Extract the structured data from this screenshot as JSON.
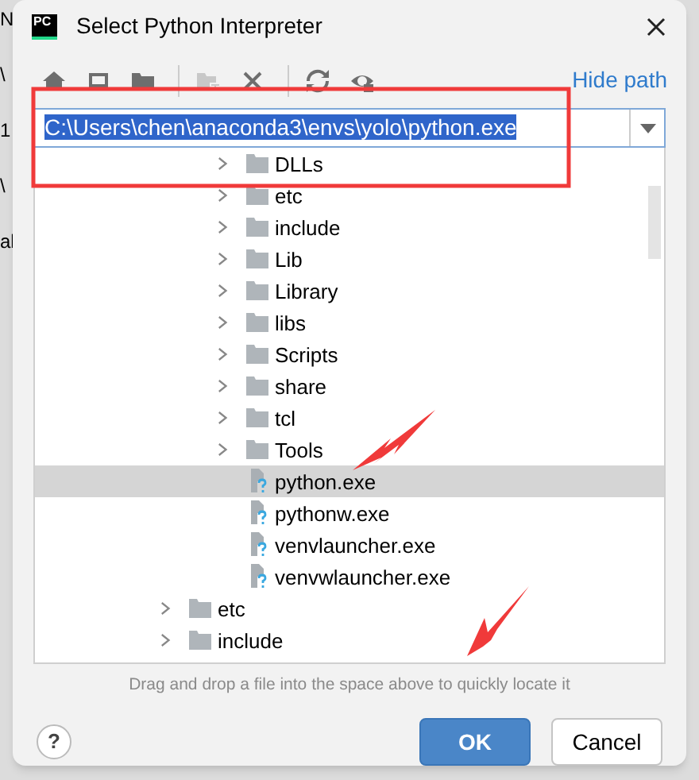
{
  "background_fragments": [
    "N",
    "\\",
    "1",
    "\\",
    "al"
  ],
  "window": {
    "title": "Select Python Interpreter",
    "logo": "PC"
  },
  "toolbar": [
    {
      "kind": "home",
      "disabled": false
    },
    {
      "kind": "desktop",
      "disabled": false
    },
    {
      "kind": "project",
      "disabled": false
    },
    {
      "kind": "separator"
    },
    {
      "kind": "new-folder",
      "disabled": true
    },
    {
      "kind": "delete",
      "disabled": false
    },
    {
      "kind": "separator"
    },
    {
      "kind": "refresh",
      "disabled": false
    },
    {
      "kind": "show-hidden",
      "disabled": false
    }
  ],
  "hide_path_link": "Hide path",
  "path_field": {
    "value": "C:\\Users\\chen\\anaconda3\\envs\\yolo\\python.exe",
    "selected": true
  },
  "tree": [
    {
      "children": [
        {
          "label": "DLLs",
          "kind": "folder",
          "expanded": false,
          "selected": false
        },
        {
          "label": "etc",
          "kind": "folder",
          "expanded": false,
          "selected": false
        },
        {
          "label": "include",
          "kind": "folder",
          "expanded": false,
          "selected": false
        },
        {
          "label": "Lib",
          "kind": "folder",
          "expanded": false,
          "selected": false
        },
        {
          "label": "Library",
          "kind": "folder",
          "expanded": false,
          "selected": false
        },
        {
          "label": "libs",
          "kind": "folder",
          "expanded": false,
          "selected": false
        },
        {
          "label": "Scripts",
          "kind": "folder",
          "expanded": false,
          "selected": false
        },
        {
          "label": "share",
          "kind": "folder",
          "expanded": false,
          "selected": false
        },
        {
          "label": "tcl",
          "kind": "folder",
          "expanded": false,
          "selected": false
        },
        {
          "label": "Tools",
          "kind": "folder",
          "expanded": false,
          "selected": false
        },
        {
          "label": "python.exe",
          "kind": "file",
          "selected": true
        },
        {
          "label": "pythonw.exe",
          "kind": "file",
          "selected": false
        },
        {
          "label": "venvlauncher.exe",
          "kind": "file",
          "selected": false
        },
        {
          "label": "venvwlauncher.exe",
          "kind": "file",
          "selected": false
        }
      ]
    },
    {
      "label": "etc",
      "kind": "folder",
      "expanded": false,
      "selected": false
    },
    {
      "label": "include",
      "kind": "folder",
      "expanded": false,
      "selected": false
    }
  ],
  "hint": "Drag and drop a file into the space above to quickly locate it",
  "help_button": "?",
  "buttons": [
    {
      "label": "OK",
      "kind": "primary"
    },
    {
      "label": "Cancel",
      "kind": "secondary"
    }
  ]
}
